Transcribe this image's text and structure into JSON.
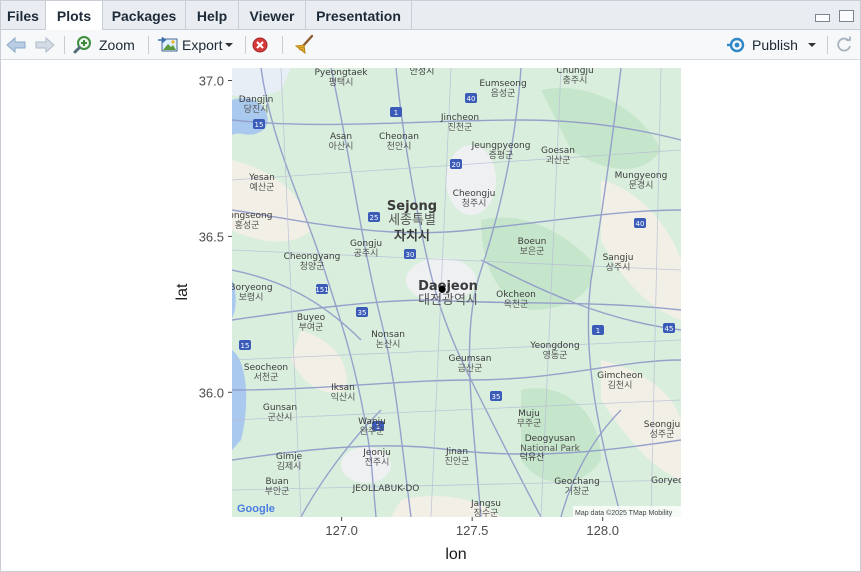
{
  "tabs": [
    {
      "label": "Files",
      "active": false
    },
    {
      "label": "Plots",
      "active": true
    },
    {
      "label": "Packages",
      "active": false
    },
    {
      "label": "Help",
      "active": false
    },
    {
      "label": "Viewer",
      "active": false
    },
    {
      "label": "Presentation",
      "active": false
    }
  ],
  "toolbar": {
    "back_icon": "arrow-left-icon",
    "forward_icon": "arrow-right-icon",
    "zoom_label": "Zoom",
    "export_label": "Export",
    "remove_icon": "remove-plot-icon",
    "clear_icon": "broom-icon",
    "publish_label": "Publish",
    "refresh_icon": "refresh-icon"
  },
  "map": {
    "labels": [
      {
        "text": "Pyeongtaek",
        "sub": "평택시"
      },
      {
        "text": "안성시"
      },
      {
        "text": "Chungju",
        "sub": "충주시"
      },
      {
        "text": "Eumseong",
        "sub": "음성군"
      },
      {
        "text": "Dangjin",
        "sub": "당진시"
      },
      {
        "text": "Jincheon",
        "sub": "진천군"
      },
      {
        "text": "Asan",
        "sub": "아산시"
      },
      {
        "text": "Cheonan",
        "sub": "천안시"
      },
      {
        "text": "Jeungpyeong",
        "sub": "증평군"
      },
      {
        "text": "Goesan",
        "sub": "괴산군"
      },
      {
        "text": "Yesan",
        "sub": "예산군"
      },
      {
        "text": "Cheongju",
        "sub": "청주시"
      },
      {
        "text": "Mungyeong",
        "sub": "문경시"
      },
      {
        "text": "Hongseong",
        "sub": "홍성군"
      },
      {
        "text": "Sejong",
        "sub": "세종특별"
      },
      {
        "text": "자치시"
      },
      {
        "text": "Gongju",
        "sub": "공주시"
      },
      {
        "text": "Boeun",
        "sub": "보은군"
      },
      {
        "text": "Sangju",
        "sub": "상주시"
      },
      {
        "text": "Cheongyang",
        "sub": "청양군"
      },
      {
        "text": "Daejeon",
        "sub": "대전광역시"
      },
      {
        "text": "Boryeong",
        "sub": "보령시"
      },
      {
        "text": "Okcheon",
        "sub": "옥천군"
      },
      {
        "text": "Buyeo",
        "sub": "부여군"
      },
      {
        "text": "Nonsan",
        "sub": "논산시"
      },
      {
        "text": "Yeongdong",
        "sub": "영동군"
      },
      {
        "text": "Geumsan",
        "sub": "금산군"
      },
      {
        "text": "Seocheon",
        "sub": "서천군"
      },
      {
        "text": "Gimcheon",
        "sub": "김천시"
      },
      {
        "text": "Iksan",
        "sub": "익산시"
      },
      {
        "text": "Gunsan",
        "sub": "군산시"
      },
      {
        "text": "Wanju",
        "sub": "완주군"
      },
      {
        "text": "Muju",
        "sub": "무주군"
      },
      {
        "text": "Seongju",
        "sub": "성주군"
      },
      {
        "text": "Deogyusan",
        "sub": "National Park"
      },
      {
        "text": "Jinan",
        "sub": "진안군"
      },
      {
        "text": "Gimje",
        "sub": "김제시"
      },
      {
        "text": "Jeonju",
        "sub": "전주시"
      },
      {
        "text": "덕유산"
      },
      {
        "text": "Geochang",
        "sub": "거창군"
      },
      {
        "text": "Buan",
        "sub": "부안군"
      },
      {
        "text": "JEOLLABUK-DO"
      },
      {
        "text": "Jangsu",
        "sub": "장수군"
      },
      {
        "text": "Goryeong"
      }
    ],
    "google_logo": "Google",
    "attribution": "Map data ©2025 TMap Mobility",
    "road_shields": [
      "15",
      "1",
      "40",
      "25",
      "30",
      "151",
      "35",
      "1",
      "40",
      "45",
      "15",
      "20",
      "35",
      "1"
    ]
  },
  "chart_data": {
    "type": "scatter",
    "xlabel": "lon",
    "ylabel": "lat",
    "xlim": [
      126.58,
      128.3
    ],
    "ylim": [
      35.6,
      37.04
    ],
    "x_ticks": [
      127.0,
      127.5,
      128.0
    ],
    "y_ticks": [
      36.0,
      36.5,
      37.0
    ],
    "x_tick_labels": [
      "127.0",
      "127.5",
      "128.0"
    ],
    "y_tick_labels": [
      "36.0",
      "36.5",
      "37.0"
    ],
    "points": [
      {
        "x": 127.385,
        "y": 36.33
      }
    ],
    "point_color": "#000000",
    "background": "map-tiles"
  }
}
